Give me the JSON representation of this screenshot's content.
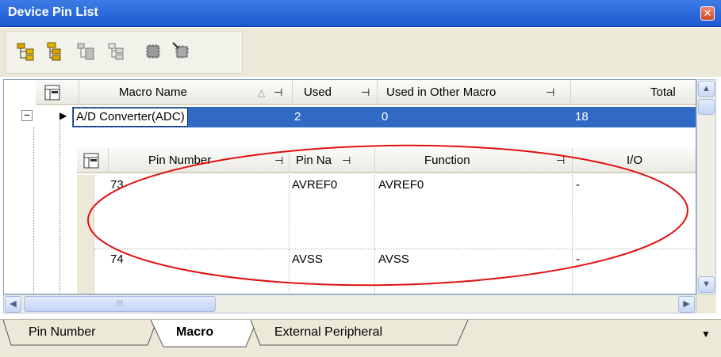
{
  "window": {
    "title": "Device Pin List",
    "close_glyph": "✕"
  },
  "toolbar": {
    "buttons": [
      "expand-all-icon",
      "collapse-all-icon",
      "show-pins-icon",
      "show-tree-icon",
      "chip-icon",
      "chip-select-icon"
    ]
  },
  "macro_table": {
    "headers": [
      "Macro Name",
      "Used",
      "Used in Other Macro",
      "Total"
    ],
    "sort_glyph": "△",
    "pin_glyph": "⊣",
    "rows": [
      {
        "expander": "⊟",
        "marker": "▶",
        "macro_name": "A/D Converter(ADC)",
        "used": "2",
        "used_in_other": "0",
        "total": "18"
      }
    ]
  },
  "pin_table": {
    "headers": [
      "Pin Number",
      "Pin Na",
      "Function",
      "I/O"
    ],
    "rows": [
      {
        "pin_number": "73",
        "pin_name": "AVREF0",
        "function": "AVREF0",
        "io": "-"
      },
      {
        "pin_number": "74",
        "pin_name": "AVSS",
        "function": "AVSS",
        "io": "-"
      }
    ]
  },
  "scroll": {
    "up": "▲",
    "down": "▼",
    "left": "◀",
    "right": "▶",
    "grip": "III"
  },
  "tabs": [
    "Pin Number",
    "Macro",
    "External Peripheral"
  ],
  "active_tab": "Macro",
  "tab_menu_glyph": "▼",
  "colors": {
    "title_bar": "#2a67dc",
    "selection": "#316ac5",
    "annotation": "#e01010"
  }
}
